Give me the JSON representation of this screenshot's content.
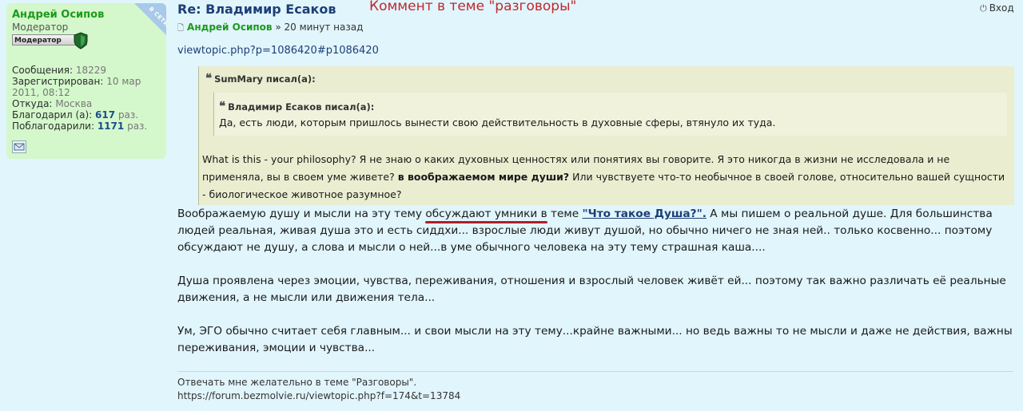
{
  "profile": {
    "online_badge": "В СЕТИ",
    "username": "Андрей Осипов",
    "rank": "Модератор",
    "rank_badge": "Модератор",
    "stats": [
      {
        "label": "Сообщения:",
        "value": "18229"
      },
      {
        "label": "Зарегистрирован:",
        "value": "10 мар 2011, 08:12"
      },
      {
        "label": "Откуда:",
        "value": "Москва"
      },
      {
        "label": "Благодарил (а):",
        "value": "617",
        "suffix": "раз."
      },
      {
        "label": "Поблагодарили:",
        "value": "1171",
        "suffix": "раз."
      }
    ],
    "pm_icon": "envelope-icon"
  },
  "post": {
    "title": "Re: Владимир Есаков",
    "annotation": "Коммент в теме \"разговоры\"",
    "login_label": "Вход",
    "author": "Андрей Осипов",
    "separator": "»",
    "time": "20 минут назад",
    "link": "viewtopic.php?p=1086420#p1086420"
  },
  "quote": {
    "author": "SumMary писал(а):",
    "inner_author": "Владимир Есаков писал(а):",
    "inner_text": "Да, есть люди, которым пришлось вынести свою действительность в духовные сферы, втянуло их туда.",
    "text_a": "What is this - your philosophy? Я не знаю о каких духовных ценностях или понятиях вы говорите. Я это никогда в жизни не исследовала и не применяла, вы в своем уме живете?",
    "text_b_bold": "в воображаемом мире души?",
    "text_c": "Или чувствуете что-то необычное в своей голове, относительно вашей сущности - биологическое животное разумное?"
  },
  "body": {
    "p1_a": "Воображаемую душу и мысли на эту тему",
    "p1_highlight": "обсуждают умники в",
    "p1_b": "теме",
    "p1_link": "\"Что такое Душа?\".",
    "p1_c": "А мы пишем о реальной душе. Для большинства людей реальная, живая душа это и есть сиддхи... взрослые люди живут душой, но обычно ничего не зная ней.. только косвенно... поэтому обсуждают не душу, а слова и мысли о ней...в уме обычного человека на эту тему страшная каша....",
    "p2": "Душа проявлена через эмоции, чувства, переживания, отношения и взрослый человек живёт ей... поэтому так важно различать её реальные движения, а не мысли или движения тела...",
    "p3": "Ум, ЭГО обычно считает себя главным... и свои мысли на эту тему...крайне важными... но ведь важны то не мысли и даже не действия, важны переживания, эмоции и чувства..."
  },
  "signature": {
    "line1": "Отвечать мне желательно в теме \"Разговоры\".",
    "line2": "https://forum.bezmolvie.ru/viewtopic.php?f=174&t=13784"
  },
  "colors": {
    "page_bg": "#e1f5fd",
    "profile_bg": "#d4f8cb",
    "quote_bg": "#ebedd0",
    "title": "#1d3f75",
    "annotation": "#c0282d",
    "username": "#1b9a1b"
  }
}
